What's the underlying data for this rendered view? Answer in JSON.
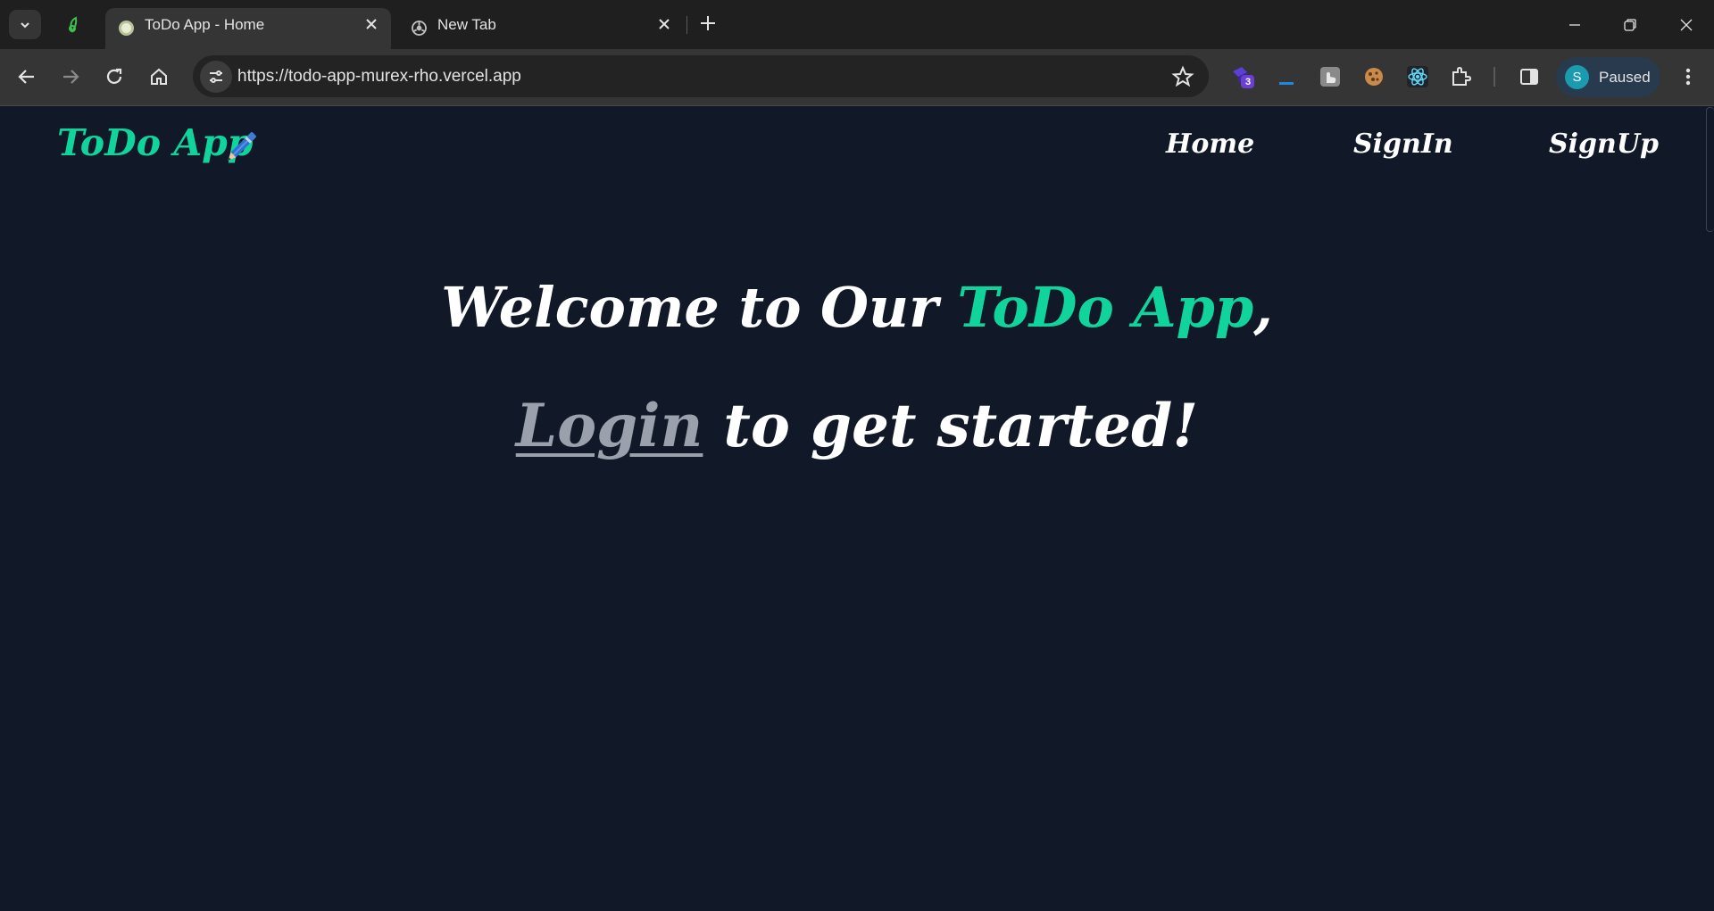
{
  "browser": {
    "tabs": [
      {
        "title": "ToDo App - Home",
        "active": true
      },
      {
        "title": "New Tab",
        "active": false
      }
    ],
    "url": "https://todo-app-murex-rho.vercel.app",
    "extensions_badge": "3",
    "profile": {
      "initial": "S",
      "label": "Paused"
    },
    "icons": [
      "tab-search-icon",
      "pinned-tab-icon",
      "close-icon",
      "new-tab-icon",
      "minimize-icon",
      "restore-icon",
      "window-close-icon",
      "back-icon",
      "forward-icon",
      "reload-icon",
      "home-icon",
      "site-info-icon",
      "bookmark-star-icon",
      "extensions-puzzle-icon",
      "side-panel-icon",
      "kebab-menu-icon"
    ]
  },
  "app": {
    "brand": "ToDo App",
    "nav": [
      {
        "label": "Home"
      },
      {
        "label": "SignIn"
      },
      {
        "label": "SignUp"
      }
    ],
    "hero": {
      "line1_prefix": "Welcome to Our ",
      "line1_accent": "ToDo App",
      "line1_suffix": ",",
      "line2_link": "Login",
      "line2_suffix": " to get started!"
    },
    "colors": {
      "background": "#111827",
      "accent": "#10d49b",
      "link_muted": "#9aa1ad",
      "text": "#ffffff"
    }
  }
}
